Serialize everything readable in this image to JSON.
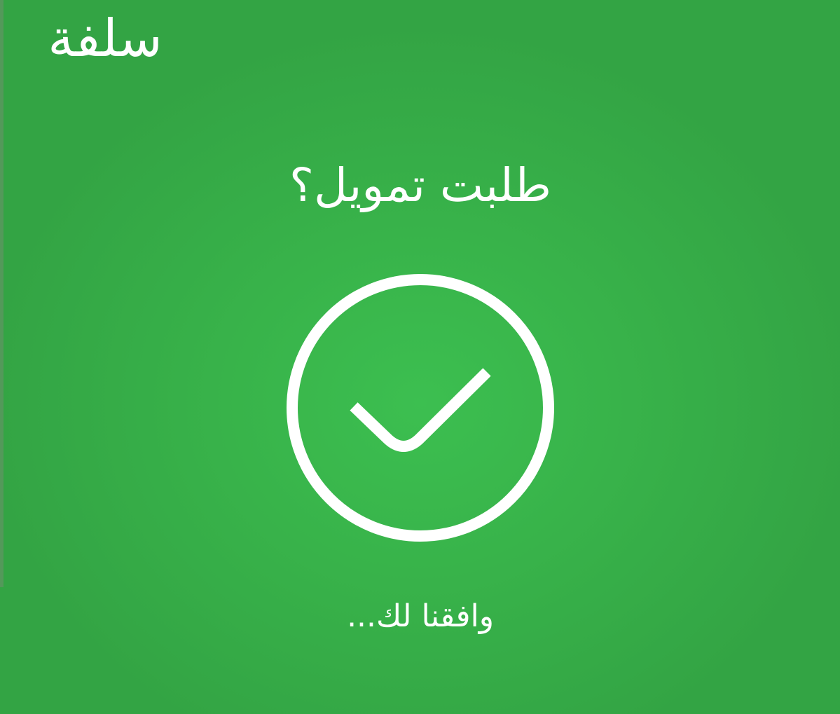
{
  "brand": {
    "name": "سلفة"
  },
  "main": {
    "headline": "طلبت تمويل؟",
    "status_icon": "check-circle-icon",
    "subtext": "وافقنا لك..."
  },
  "colors": {
    "background": "#38b34a",
    "foreground": "#ffffff"
  }
}
